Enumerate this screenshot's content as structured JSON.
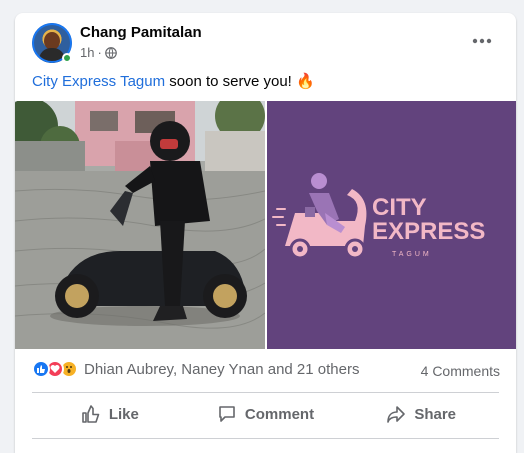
{
  "post": {
    "author": "Chang Pamitalan",
    "time": "1h",
    "separator": "·",
    "text_link": "City Express Tagum",
    "text_rest": " soon to serve you!",
    "emoji": "🔥",
    "privacy_icon": "globe-icon"
  },
  "photos": {
    "right_logo": {
      "line1": "CITY",
      "line2": "EXPRESS",
      "line3": "TAGUM"
    }
  },
  "engagement": {
    "reaction_icons": [
      "like-icon",
      "love-icon",
      "wow-icon"
    ],
    "reaction_names": "Dhian Aubrey, Naney Ynan and 21 others",
    "comments": "4 Comments"
  },
  "actions": {
    "like_label": "Like",
    "comment_label": "Comment",
    "share_label": "Share"
  },
  "colors": {
    "link_blue": "#216fdb",
    "brand_purple": "#62437d",
    "logo_pink": "#f2b8c6",
    "online_green": "#31a24c"
  }
}
